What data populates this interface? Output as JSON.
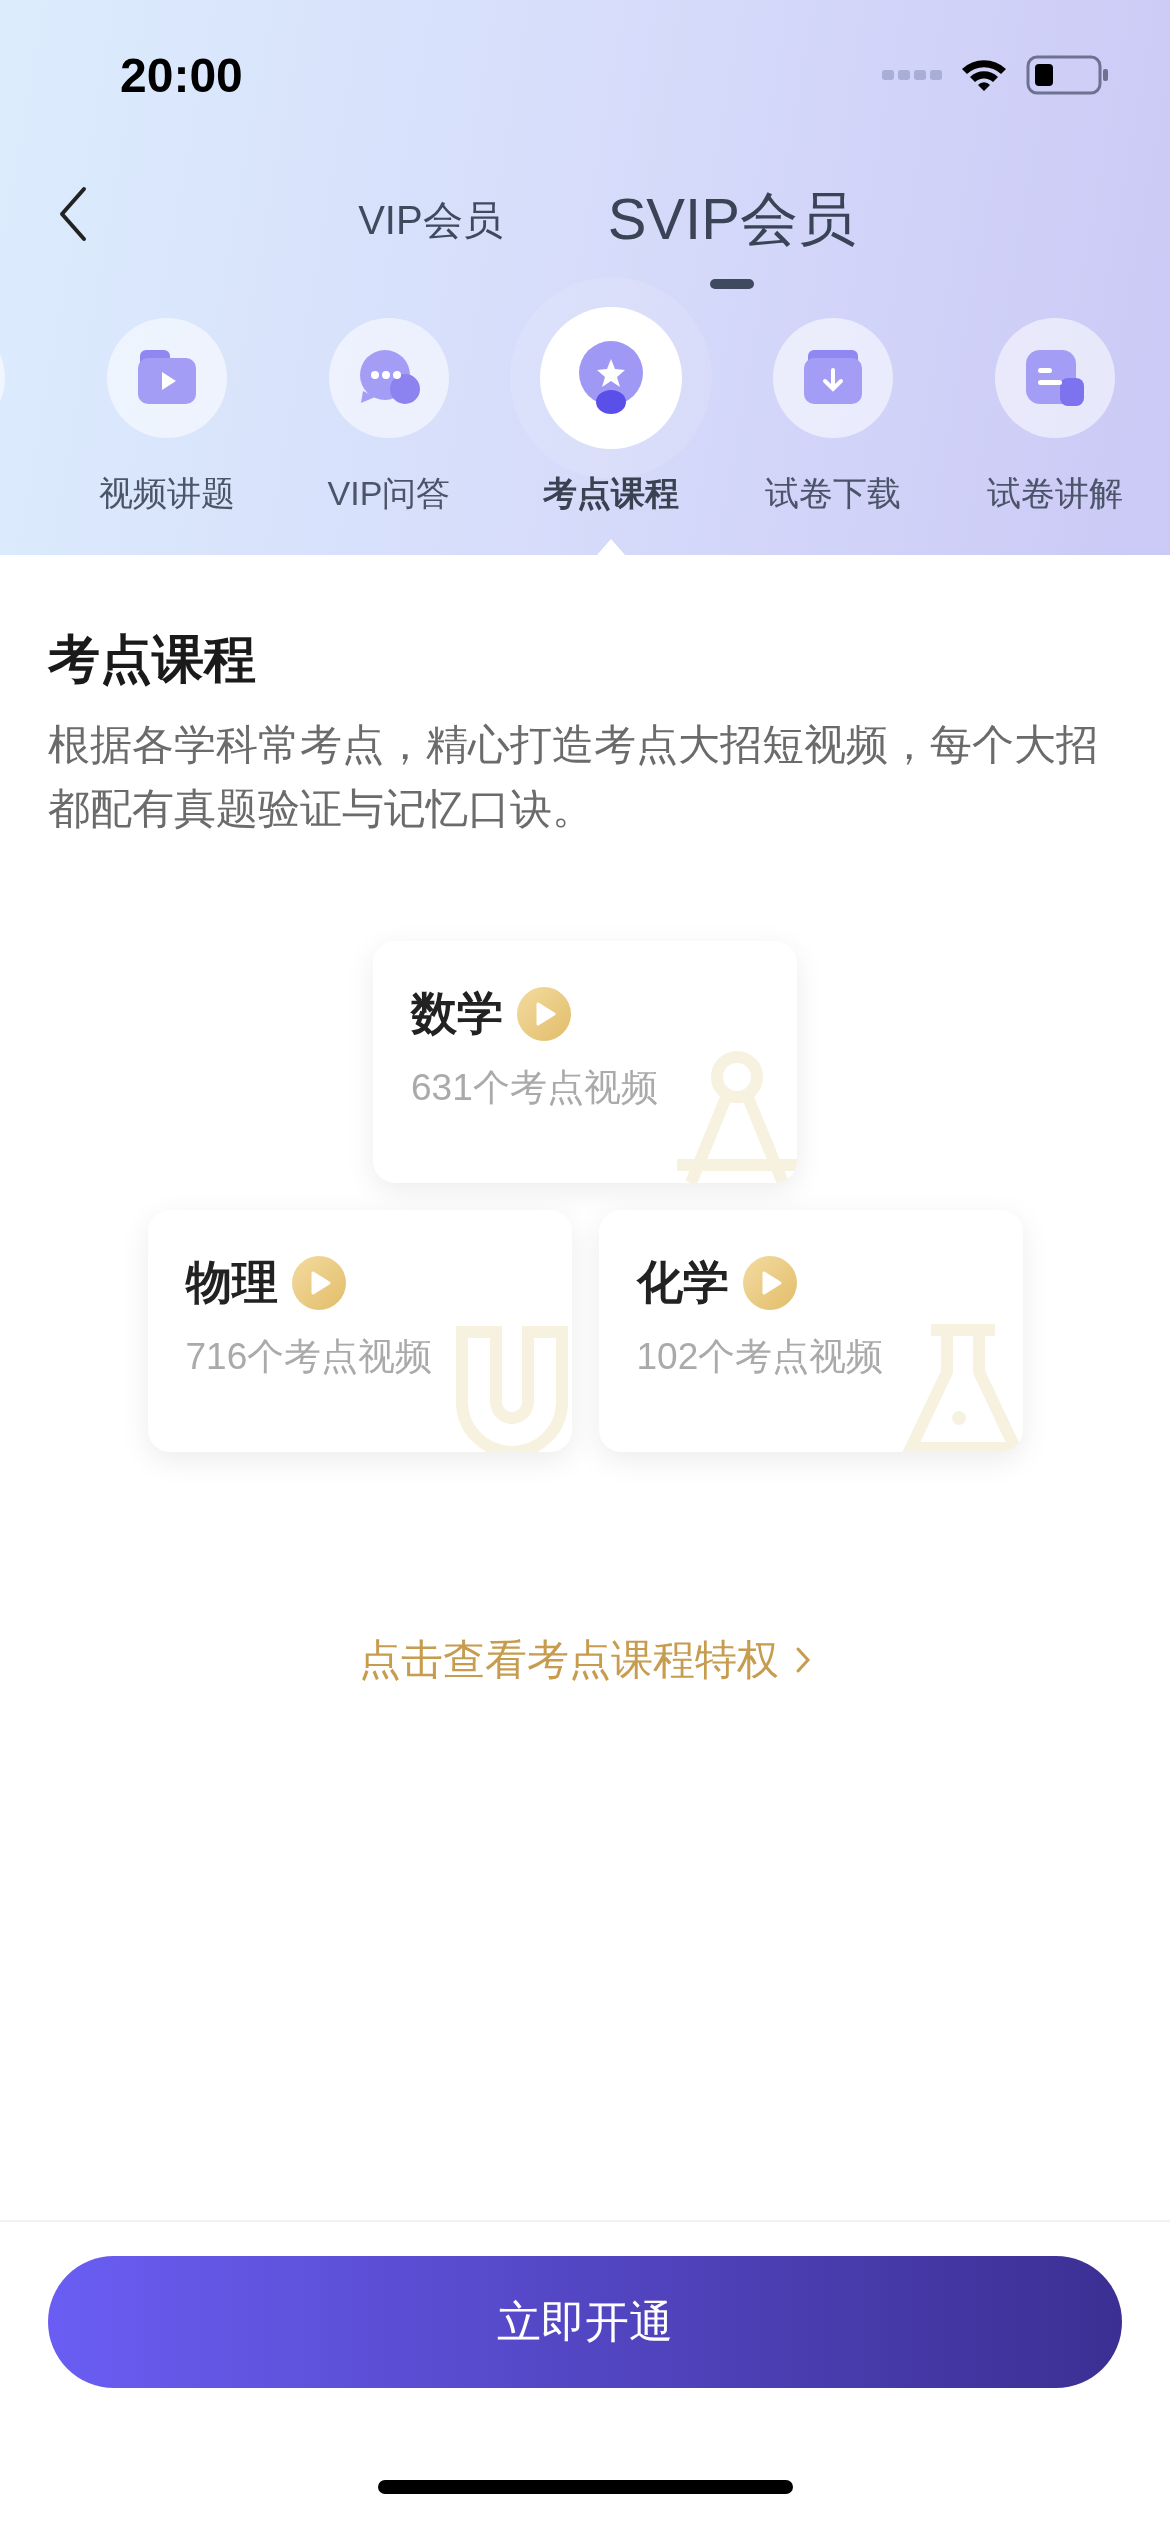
{
  "status_bar": {
    "time": "20:00"
  },
  "nav": {
    "tabs": [
      {
        "label": "VIP会员",
        "selected": false
      },
      {
        "label": "SVIP会员",
        "selected": true
      }
    ]
  },
  "features": [
    {
      "label": "视频讲题",
      "kind": "video",
      "selected": false
    },
    {
      "label": "VIP问答",
      "kind": "chat",
      "selected": false
    },
    {
      "label": "考点课程",
      "kind": "star",
      "selected": true
    },
    {
      "label": "试卷下载",
      "kind": "download",
      "selected": false
    },
    {
      "label": "试卷讲解",
      "kind": "doc",
      "selected": false
    }
  ],
  "section": {
    "title": "考点课程",
    "description": "根据各学科常考点，精心打造考点大招短视频，每个大招都配有真题验证与记忆口诀。"
  },
  "subjects": [
    {
      "name": "数学",
      "count": "631个考点视频",
      "kind": "compass"
    },
    {
      "name": "物理",
      "count": "716个考点视频",
      "kind": "magnet"
    },
    {
      "name": "化学",
      "count": "102个考点视频",
      "kind": "flask"
    }
  ],
  "privilege_link": "点击查看考点课程特权",
  "cta": "立即开通"
}
